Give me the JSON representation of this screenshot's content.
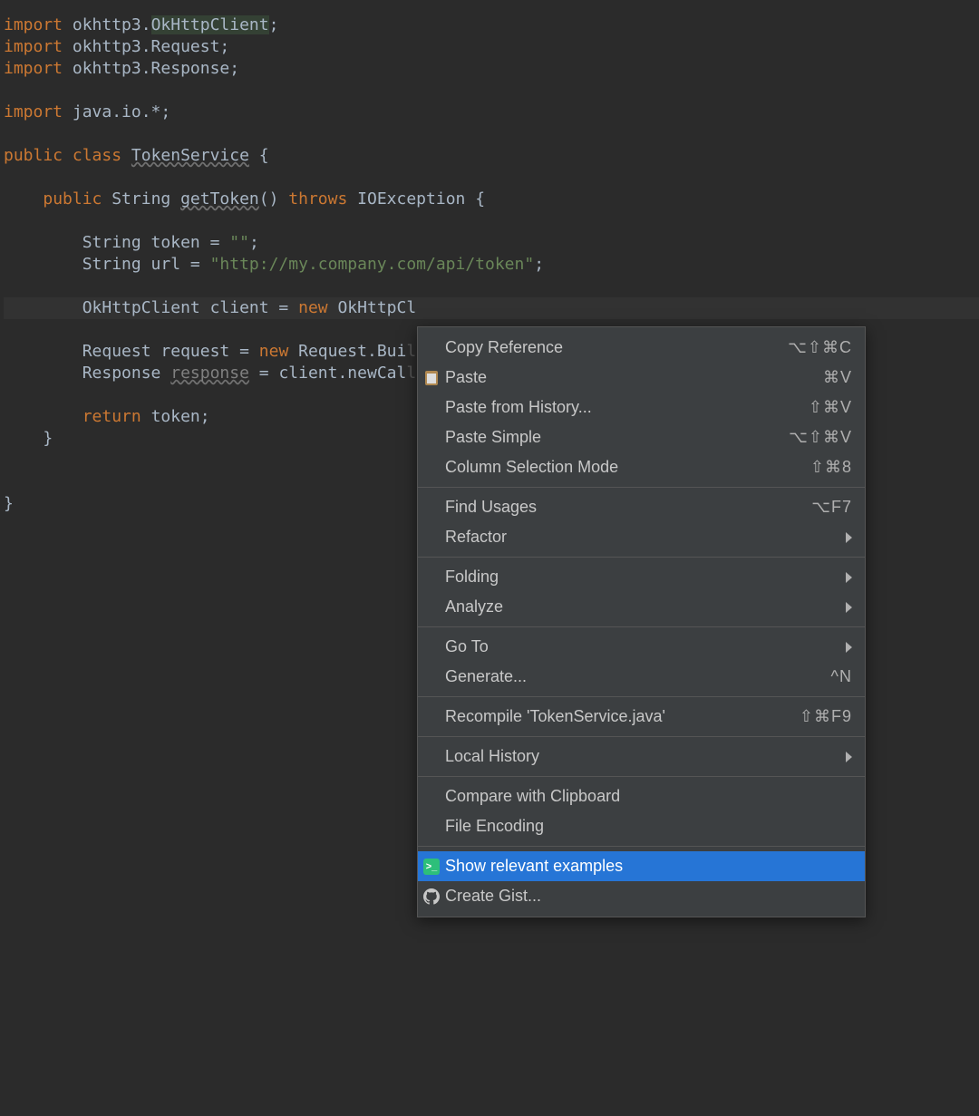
{
  "code": {
    "lines": [
      {
        "tokens": [
          [
            "kw",
            "import "
          ],
          [
            "ident",
            "okhttp3."
          ],
          [
            "highlighted",
            "OkHttpClient"
          ],
          [
            "ident",
            ";"
          ]
        ]
      },
      {
        "tokens": [
          [
            "kw",
            "import "
          ],
          [
            "ident",
            "okhttp3.Request;"
          ]
        ]
      },
      {
        "tokens": [
          [
            "kw",
            "import "
          ],
          [
            "ident",
            "okhttp3.Response;"
          ]
        ]
      },
      {
        "tokens": []
      },
      {
        "tokens": [
          [
            "kw",
            "import "
          ],
          [
            "ident",
            "java.io.*;"
          ]
        ]
      },
      {
        "tokens": []
      },
      {
        "tokens": [
          [
            "kw",
            "public class "
          ],
          [
            "warn",
            "TokenService"
          ],
          [
            "ident",
            " {"
          ]
        ]
      },
      {
        "tokens": []
      },
      {
        "tokens": [
          [
            "ident",
            "    "
          ],
          [
            "kw",
            "public "
          ],
          [
            "ident",
            "String "
          ],
          [
            "warn",
            "getToken"
          ],
          [
            "ident",
            "() "
          ],
          [
            "kw",
            "throws "
          ],
          [
            "ident",
            "IOException {"
          ]
        ]
      },
      {
        "tokens": []
      },
      {
        "tokens": [
          [
            "ident",
            "        String token = "
          ],
          [
            "str",
            "\"\""
          ],
          [
            "ident",
            ";"
          ]
        ]
      },
      {
        "tokens": [
          [
            "ident",
            "        String url = "
          ],
          [
            "str",
            "\"http://my.company.com/api/token\""
          ],
          [
            "ident",
            ";"
          ]
        ]
      },
      {
        "tokens": []
      },
      {
        "tokens": [
          [
            "ident",
            "        OkHttpClient client = "
          ],
          [
            "kw",
            "new "
          ],
          [
            "ident",
            "OkHttpCl"
          ]
        ],
        "caret": true
      },
      {
        "tokens": []
      },
      {
        "tokens": [
          [
            "ident",
            "        Request request = "
          ],
          [
            "kw",
            "new "
          ],
          [
            "ident",
            "Request.Bui"
          ]
        ],
        "faded_suffix": "lder().url(url).build();"
      },
      {
        "tokens": [
          [
            "ident",
            "        Response "
          ],
          [
            "unused",
            "response"
          ],
          [
            "ident",
            " = client.newCal"
          ]
        ],
        "faded_suffix": "l(request).execute();"
      },
      {
        "tokens": []
      },
      {
        "tokens": [
          [
            "ident",
            "        "
          ],
          [
            "kw",
            "return "
          ],
          [
            "ident",
            "token;"
          ]
        ]
      },
      {
        "tokens": [
          [
            "ident",
            "    }"
          ]
        ]
      },
      {
        "tokens": []
      },
      {
        "tokens": []
      },
      {
        "tokens": [
          [
            "ident",
            "}"
          ]
        ]
      }
    ]
  },
  "menu": {
    "groups": [
      [
        {
          "label": "Copy Reference",
          "shortcut": "⌥⇧⌘C"
        },
        {
          "label": "Paste",
          "shortcut": "⌘V",
          "icon": "paste"
        },
        {
          "label": "Paste from History...",
          "shortcut": "⇧⌘V"
        },
        {
          "label": "Paste Simple",
          "shortcut": "⌥⇧⌘V"
        },
        {
          "label": "Column Selection Mode",
          "shortcut": "⇧⌘8"
        }
      ],
      [
        {
          "label": "Find Usages",
          "shortcut": "⌥F7"
        },
        {
          "label": "Refactor",
          "submenu": true
        }
      ],
      [
        {
          "label": "Folding",
          "submenu": true
        },
        {
          "label": "Analyze",
          "submenu": true
        }
      ],
      [
        {
          "label": "Go To",
          "submenu": true
        },
        {
          "label": "Generate...",
          "shortcut": "^N"
        }
      ],
      [
        {
          "label": "Recompile 'TokenService.java'",
          "shortcut": "⇧⌘F9"
        }
      ],
      [
        {
          "label": "Local History",
          "submenu": true
        }
      ],
      [
        {
          "label": "Compare with Clipboard"
        },
        {
          "label": "File Encoding"
        }
      ],
      [
        {
          "label": "Show relevant examples",
          "icon": "terminal",
          "selected": true
        },
        {
          "label": "Create Gist...",
          "icon": "github"
        }
      ]
    ]
  }
}
